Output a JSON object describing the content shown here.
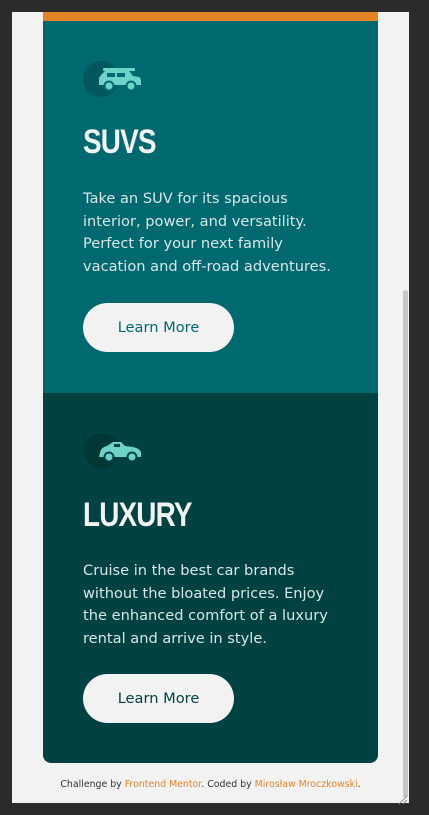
{
  "cards": [
    {
      "id": "suvs",
      "icon": "suv-car-icon",
      "title": "SUVS",
      "text": "Take an SUV for its spacious interior, power, and versatility. Perfect for your next family vacation and off-road adventures.",
      "button_label": "Learn More",
      "bg_color": "#006970"
    },
    {
      "id": "luxury",
      "icon": "luxury-car-icon",
      "title": "LUXURY",
      "text": "Cruise in the best car brands without the bloated prices. Enjoy the enhanced comfort of a luxury rental and arrive in style.",
      "button_label": "Learn More",
      "bg_color": "#004241"
    }
  ],
  "accent_color": "#e28625",
  "footer": {
    "prefix": "Challenge by ",
    "link1": "Frontend Mentor",
    "middle": ". Coded by ",
    "link2": "Mirosław Mroczkowski",
    "suffix": "."
  }
}
